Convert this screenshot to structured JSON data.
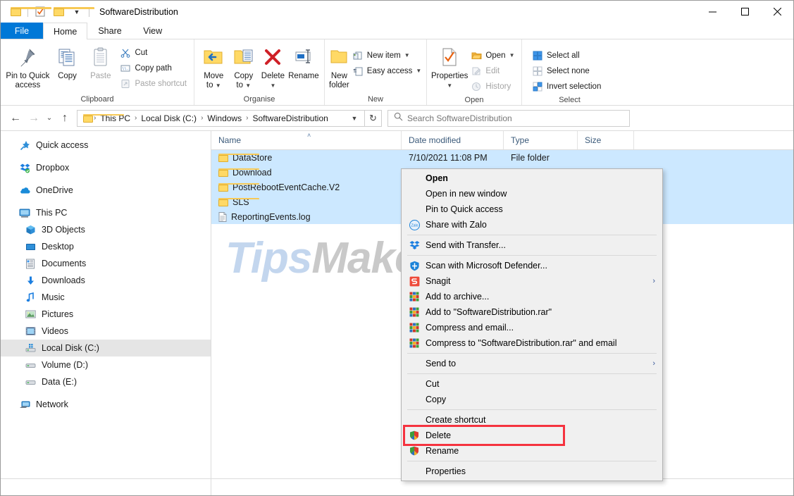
{
  "window": {
    "title": "SoftwareDistribution",
    "quick_access": [
      "folder-icon",
      "properties-icon",
      "new-folder-icon",
      "customize-dropdown"
    ],
    "caption": {
      "minimize": "–",
      "maximize": "□",
      "close": "✕"
    }
  },
  "tabs": [
    {
      "label": "File",
      "kind": "file"
    },
    {
      "label": "Home",
      "kind": "active"
    },
    {
      "label": "Share",
      "kind": "normal"
    },
    {
      "label": "View",
      "kind": "normal"
    }
  ],
  "ribbon": {
    "groups": [
      {
        "caption": "Clipboard",
        "big": [
          {
            "label": "Pin to Quick\naccess",
            "icon": "pin-icon",
            "line1": "Pin to Quick",
            "line2": "access"
          },
          {
            "label": "Copy",
            "icon": "copy-icon",
            "line1": "Copy",
            "line2": ""
          },
          {
            "label": "Paste",
            "icon": "paste-icon",
            "line1": "Paste",
            "line2": "",
            "dim": true
          }
        ],
        "small": [
          {
            "label": "Cut",
            "icon": "scissors-icon",
            "dim": false
          },
          {
            "label": "Copy path",
            "icon": "copy-path-icon",
            "dim": false
          },
          {
            "label": "Paste shortcut",
            "icon": "paste-shortcut-icon",
            "dim": true
          }
        ]
      },
      {
        "caption": "Organise",
        "big": [
          {
            "line1": "Move",
            "line2": "to",
            "icon": "move-to-icon",
            "caret": true
          },
          {
            "line1": "Copy",
            "line2": "to",
            "icon": "copy-to-icon",
            "caret": true
          },
          {
            "line1": "Delete",
            "line2": "",
            "icon": "delete-x-icon",
            "caret": true
          },
          {
            "line1": "Rename",
            "line2": "",
            "icon": "rename-icon",
            "caret": false
          }
        ],
        "small": []
      },
      {
        "caption": "New",
        "big": [
          {
            "line1": "New",
            "line2": "folder",
            "icon": "new-folder-icon",
            "caret": false
          }
        ],
        "small": [
          {
            "label": "New item",
            "icon": "new-item-icon",
            "caret": true
          },
          {
            "label": "Easy access",
            "icon": "easy-access-icon",
            "caret": true
          }
        ]
      },
      {
        "caption": "Open",
        "big": [
          {
            "line1": "Properties",
            "line2": "",
            "icon": "properties-icon",
            "caret": true
          }
        ],
        "small": [
          {
            "label": "Open",
            "icon": "open-folder-icon",
            "caret": true
          },
          {
            "label": "Edit",
            "icon": "edit-icon",
            "dim": true
          },
          {
            "label": "History",
            "icon": "history-icon",
            "dim": true
          }
        ]
      },
      {
        "caption": "Select",
        "big": [],
        "small": [
          {
            "label": "Select all",
            "icon": "select-all-icon"
          },
          {
            "label": "Select none",
            "icon": "select-none-icon"
          },
          {
            "label": "Invert selection",
            "icon": "invert-selection-icon"
          }
        ]
      }
    ]
  },
  "address": {
    "back": "←",
    "forward": "→",
    "recent": "⌄",
    "up": "↑",
    "crumbs": [
      "This PC",
      "Local Disk (C:)",
      "Windows",
      "SoftwareDistribution"
    ],
    "separator": "›",
    "refresh": "↻",
    "search_placeholder": "Search SoftwareDistribution"
  },
  "nav_pane": {
    "items": [
      {
        "label": "Quick access",
        "icon": "pin-star-icon",
        "indent": false,
        "selected": false,
        "gap_after": true
      },
      {
        "label": "Dropbox",
        "icon": "dropbox-icon",
        "indent": false,
        "selected": false,
        "gap_after": true
      },
      {
        "label": "OneDrive",
        "icon": "onedrive-icon",
        "indent": false,
        "selected": false,
        "gap_after": true
      },
      {
        "label": "This PC",
        "icon": "this-pc-icon",
        "indent": false,
        "selected": false,
        "gap_after": false
      },
      {
        "label": "3D Objects",
        "icon": "3d-objects-icon",
        "indent": true,
        "selected": false,
        "gap_after": false
      },
      {
        "label": "Desktop",
        "icon": "desktop-icon",
        "indent": true,
        "selected": false,
        "gap_after": false
      },
      {
        "label": "Documents",
        "icon": "documents-icon",
        "indent": true,
        "selected": false,
        "gap_after": false
      },
      {
        "label": "Downloads",
        "icon": "downloads-icon",
        "indent": true,
        "selected": false,
        "gap_after": false
      },
      {
        "label": "Music",
        "icon": "music-icon",
        "indent": true,
        "selected": false,
        "gap_after": false
      },
      {
        "label": "Pictures",
        "icon": "pictures-icon",
        "indent": true,
        "selected": false,
        "gap_after": false
      },
      {
        "label": "Videos",
        "icon": "videos-icon",
        "indent": true,
        "selected": false,
        "gap_after": false
      },
      {
        "label": "Local Disk (C:)",
        "icon": "local-disk-icon",
        "indent": true,
        "selected": true,
        "gap_after": false
      },
      {
        "label": "Volume (D:)",
        "icon": "drive-icon",
        "indent": true,
        "selected": false,
        "gap_after": false
      },
      {
        "label": "Data (E:)",
        "icon": "drive-icon",
        "indent": true,
        "selected": false,
        "gap_after": true
      },
      {
        "label": "Network",
        "icon": "network-icon",
        "indent": false,
        "selected": false,
        "gap_after": false
      }
    ]
  },
  "file_list": {
    "columns": [
      "Name",
      "Date modified",
      "Type",
      "Size"
    ],
    "sort_indicator": "˄",
    "rows": [
      {
        "name": "DataStore",
        "icon": "folder-icon",
        "date": "7/10/2021 11:08 PM",
        "type": "File folder",
        "size": "",
        "selected": true
      },
      {
        "name": "Download",
        "icon": "folder-icon",
        "date": "",
        "type": "",
        "size": "",
        "selected": true
      },
      {
        "name": "PostRebootEventCache.V2",
        "icon": "folder-icon",
        "date": "",
        "type": "",
        "size": "",
        "selected": true
      },
      {
        "name": "SLS",
        "icon": "folder-icon",
        "date": "",
        "type": "",
        "size": "",
        "selected": true
      },
      {
        "name": "ReportingEvents.log",
        "icon": "log-file-icon",
        "date": "",
        "type": "",
        "size": "",
        "selected": true
      }
    ]
  },
  "watermark": {
    "part1": "Tips",
    "part2": "Make"
  },
  "context_menu": {
    "items": [
      {
        "label": "Open",
        "icon": "",
        "bold": true,
        "kind": "item"
      },
      {
        "label": "Open in new window",
        "icon": "",
        "kind": "item"
      },
      {
        "label": "Pin to Quick access",
        "icon": "",
        "kind": "item"
      },
      {
        "label": "Share with Zalo",
        "icon": "zalo-icon",
        "kind": "item"
      },
      {
        "kind": "separator"
      },
      {
        "label": "Send with Transfer...",
        "icon": "dropbox-icon",
        "kind": "item"
      },
      {
        "kind": "separator"
      },
      {
        "label": "Scan with Microsoft Defender...",
        "icon": "defender-shield-icon",
        "kind": "item"
      },
      {
        "label": "Snagit",
        "icon": "snagit-icon",
        "kind": "item",
        "arrow": "›"
      },
      {
        "label": "Add to archive...",
        "icon": "winrar-icon",
        "kind": "item"
      },
      {
        "label": "Add to \"SoftwareDistribution.rar\"",
        "icon": "winrar-icon",
        "kind": "item"
      },
      {
        "label": "Compress and email...",
        "icon": "winrar-icon",
        "kind": "item"
      },
      {
        "label": "Compress to \"SoftwareDistribution.rar\" and email",
        "icon": "winrar-icon",
        "kind": "item"
      },
      {
        "kind": "separator"
      },
      {
        "label": "Send to",
        "icon": "",
        "kind": "item",
        "arrow": "›"
      },
      {
        "kind": "separator"
      },
      {
        "label": "Cut",
        "icon": "",
        "kind": "item"
      },
      {
        "label": "Copy",
        "icon": "",
        "kind": "item"
      },
      {
        "kind": "separator"
      },
      {
        "label": "Create shortcut",
        "icon": "",
        "kind": "item"
      },
      {
        "label": "Delete",
        "icon": "uac-shield-icon",
        "kind": "item",
        "highlight": true
      },
      {
        "label": "Rename",
        "icon": "uac-shield-icon",
        "kind": "item"
      },
      {
        "kind": "separator"
      },
      {
        "label": "Properties",
        "icon": "",
        "kind": "item"
      }
    ],
    "highlight_color": "#f5333f"
  },
  "colors": {
    "accent": "#0078d7",
    "selection": "#cce8ff",
    "menu_bg": "#f0f0f0",
    "highlight": "#f5333f",
    "folder_yellow": "#ffd966"
  }
}
